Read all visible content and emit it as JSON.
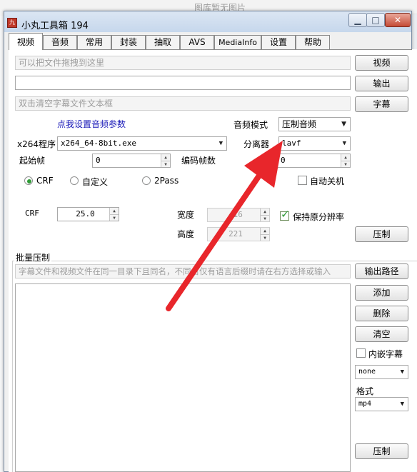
{
  "background": {
    "text": "图库暂无图片"
  },
  "window": {
    "title": "小丸工具箱 194",
    "icon": "九"
  },
  "tabs": [
    "视频",
    "音频",
    "常用",
    "封装",
    "抽取",
    "AVS",
    "MediaInfo",
    "设置",
    "帮助"
  ],
  "video": {
    "drop_hint": "可以把文件拖拽到这里",
    "output_value": "",
    "subtitle_hint": "双击清空字幕文件文本框",
    "btn_video": "视频",
    "btn_output": "输出",
    "btn_subtitle": "字幕",
    "audio_link": "点我设置音频参数",
    "x264_label": "x264程序",
    "x264_value": "x264_64-8bit.exe",
    "audio_mode_label": "音频模式",
    "audio_mode_value": "压制音频",
    "demuxer_label": "分离器",
    "demuxer_value": "lavf",
    "start_frame_label": "起始帧",
    "start_frame_value": "0",
    "encode_frames_label": "编码帧数",
    "encode_frames_value": "0",
    "rc_modes": [
      "CRF",
      "自定义",
      "2Pass"
    ],
    "auto_shutdown": "自动关机",
    "crf_label": "CRF",
    "crf_value": "25.0",
    "width_label": "宽度",
    "width_value": "416",
    "height_label": "高度",
    "height_value": "221",
    "keep_res": "保持原分辨率",
    "btn_encode": "压制"
  },
  "batch": {
    "group_title": "批量压制",
    "hint": "字幕文件和视频文件在同一目录下且同名，不同名仅有语言后缀时请在右方选择或输入",
    "btn_output_path": "输出路径",
    "btn_add": "添加",
    "btn_delete": "删除",
    "btn_clear": "清空",
    "embed_sub": "内嵌字幕",
    "sub_lang_value": "none",
    "format_label": "格式",
    "format_value": "mp4",
    "btn_encode": "压制"
  },
  "colors": {
    "annotation_arrow": "#e8262b",
    "link": "#1a1ab8",
    "radio_dot": "#2f9b36",
    "check": "#2f9b36"
  },
  "icons": {
    "arrow": "annotation-arrow-icon",
    "check": "checkmark-icon",
    "dropdown": "chevron-down-icon"
  }
}
